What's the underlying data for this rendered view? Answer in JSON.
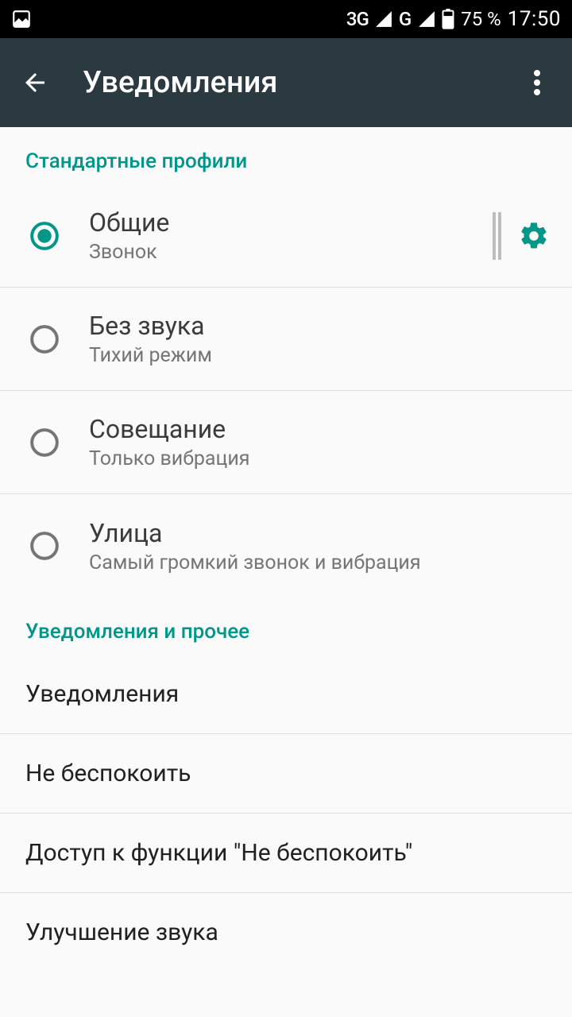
{
  "status": {
    "network1": "3G",
    "network2": "G",
    "battery_pct": "75 %",
    "time": "17:50"
  },
  "appbar": {
    "title": "Уведомления"
  },
  "sections": {
    "profiles_header": "Стандартные профили",
    "other_header": "Уведомления и прочее"
  },
  "profiles": [
    {
      "title": "Общие",
      "subtitle": "Звонок",
      "selected": true,
      "has_gear": true
    },
    {
      "title": "Без звука",
      "subtitle": "Тихий режим",
      "selected": false,
      "has_gear": false
    },
    {
      "title": "Совещание",
      "subtitle": "Только вибрация",
      "selected": false,
      "has_gear": false
    },
    {
      "title": "Улица",
      "subtitle": "Самый громкий звонок и вибрация",
      "selected": false,
      "has_gear": false
    }
  ],
  "other": [
    {
      "label": "Уведомления"
    },
    {
      "label": "Не беспокоить"
    },
    {
      "label": "Доступ к функции \"Не беспокоить\""
    },
    {
      "label": "Улучшение звука"
    }
  ]
}
